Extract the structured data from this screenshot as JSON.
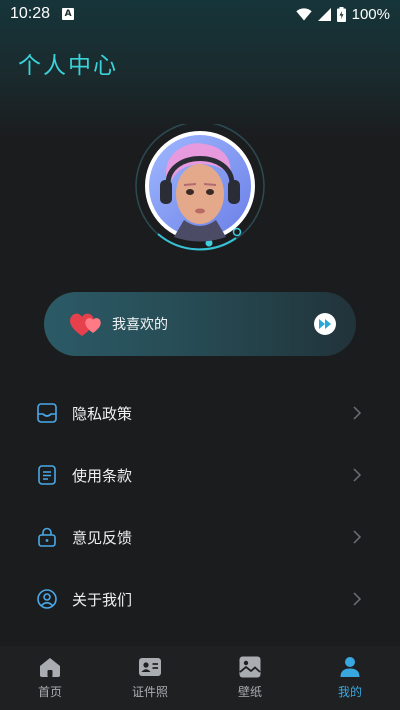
{
  "status_bar": {
    "time": "10:28",
    "battery": "100%"
  },
  "header": {
    "title": "个人中心"
  },
  "favorites": {
    "label": "我喜欢的"
  },
  "menu": {
    "items": [
      {
        "label": "隐私政策",
        "icon": "inbox-icon"
      },
      {
        "label": "使用条款",
        "icon": "document-icon"
      },
      {
        "label": "意见反馈",
        "icon": "lock-icon"
      },
      {
        "label": "关于我们",
        "icon": "user-circle-icon"
      }
    ]
  },
  "tab_bar": {
    "tabs": [
      {
        "label": "首页",
        "icon": "home-icon",
        "active": false
      },
      {
        "label": "证件照",
        "icon": "id-card-icon",
        "active": false
      },
      {
        "label": "壁纸",
        "icon": "wallpaper-icon",
        "active": false
      },
      {
        "label": "我的",
        "icon": "profile-icon",
        "active": true
      }
    ]
  },
  "colors": {
    "accent": "#3ad2d8",
    "tab_active": "#3aa8e0",
    "background": "#1b1c1e"
  }
}
